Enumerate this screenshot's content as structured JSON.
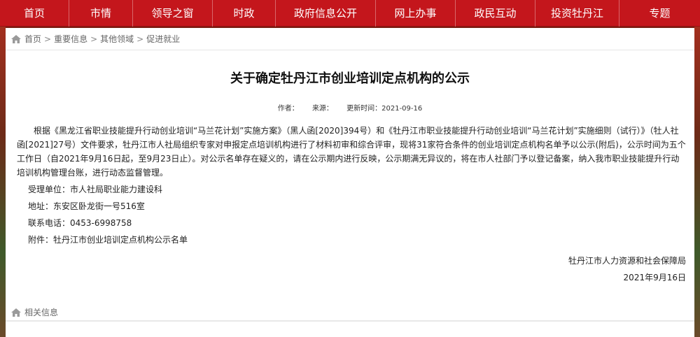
{
  "nav": {
    "items": [
      {
        "label": "首页",
        "w": 99
      },
      {
        "label": "市情",
        "w": 91
      },
      {
        "label": "领导之窗",
        "w": 114
      },
      {
        "label": "时政",
        "w": 90
      },
      {
        "label": "政府信息公开",
        "w": 143
      },
      {
        "label": "网上办事",
        "w": 114
      },
      {
        "label": "政民互动",
        "w": 114
      },
      {
        "label": "投资牡丹江",
        "w": 120
      },
      {
        "label": "专题",
        "w": 115
      }
    ]
  },
  "breadcrumb": {
    "items": [
      "首页",
      "重要信息",
      "其他领域",
      "促进就业"
    ]
  },
  "article": {
    "title": "关于确定牡丹江市创业培训定点机构的公示",
    "author_label": "作者：",
    "source_label": "来源：",
    "updated_label": "更新时间：2021-09-16",
    "body": "根据《黑龙江省职业技能提升行动创业培训“马兰花计划”实施方案》（黑人函[2020]394号）和《牡丹江市职业技能提升行动创业培训“马兰花计划”实施细则（试行）》（牡人社函[2021]27号）文件要求，牡丹江市人社局组织专家对申报定点培训机构进行了材料初审和综合评审，现将31家符合条件的创业培训定点机构名单予以公示(附后)，公示时间为五个工作日（自2021年9月16日起，至9月23日止）。对公示名单存在疑义的，请在公示期内进行反映，公示期满无异议的，将在市人社部门予以登记备案，纳入我市职业技能提升行动培训机构管理台账，进行动态监督管理。",
    "dept": "受理单位：市人社局职业能力建设科",
    "address": "地址：东安区卧龙街一号516室",
    "phone": "联系电话：0453-6998758",
    "attachment": "附件：牡丹江市创业培训定点机构公示名单",
    "signer": "牡丹江市人力资源和社会保障局",
    "date": "2021年9月16日"
  },
  "related": {
    "label": "相关信息"
  }
}
